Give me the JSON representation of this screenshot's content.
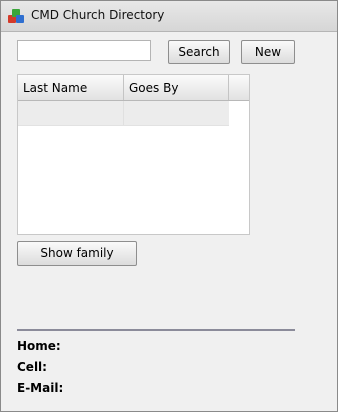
{
  "window": {
    "title": "CMD Church Directory",
    "icon": "app-blocks-icon"
  },
  "search": {
    "value": "",
    "placeholder": ""
  },
  "buttons": {
    "search_label": "Search",
    "new_label": "New",
    "show_family_label": "Show family"
  },
  "table": {
    "columns": [
      "Last Name",
      "Goes By",
      ""
    ],
    "rows": [
      [
        "",
        ""
      ]
    ]
  },
  "contact": {
    "home_label": "Home:",
    "cell_label": "Cell:",
    "email_label": "E-Mail:"
  },
  "colors": {
    "window_bg": "#f0f0f0",
    "icon_red": "#d43a2a",
    "icon_green": "#3aa63a",
    "icon_blue": "#2f6fd0"
  }
}
